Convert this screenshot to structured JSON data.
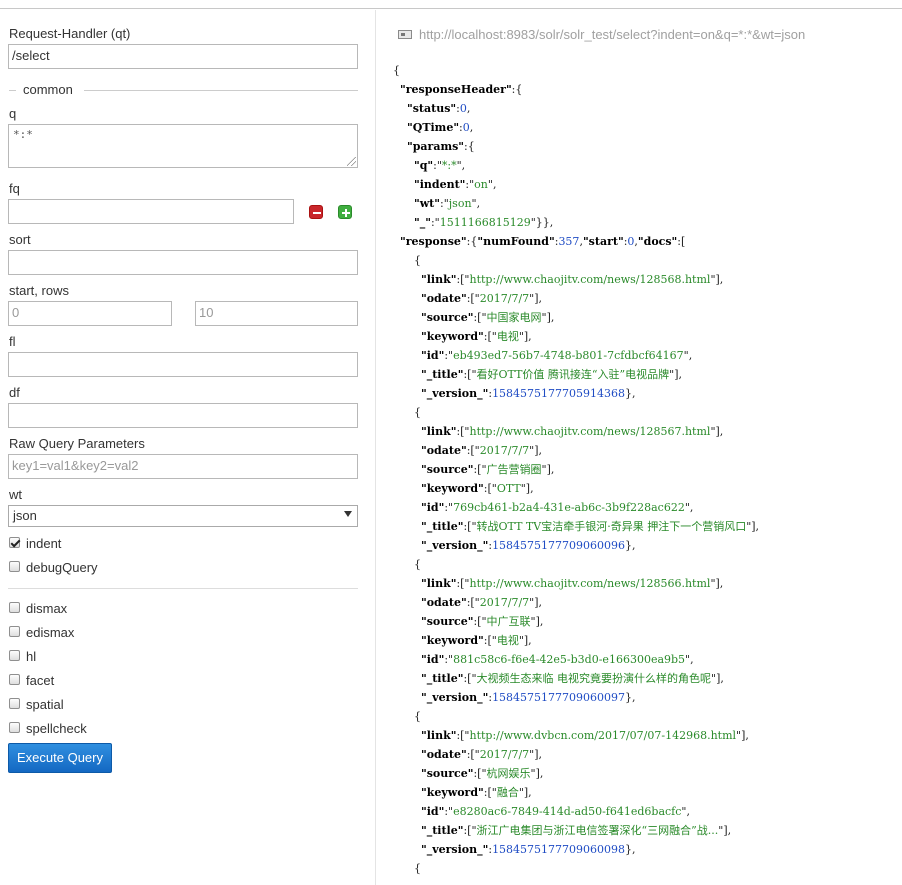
{
  "form": {
    "request_handler_label": "Request-Handler (qt)",
    "request_handler_value": "/select",
    "common_label": "common",
    "q_label": "q",
    "q_value": "*:*",
    "fq_label": "fq",
    "fq_value": "",
    "sort_label": "sort",
    "sort_value": "",
    "start_rows_label": "start, rows",
    "start_placeholder": "0",
    "rows_placeholder": "10",
    "fl_label": "fl",
    "fl_value": "",
    "df_label": "df",
    "df_value": "",
    "raw_label": "Raw Query Parameters",
    "raw_placeholder": "key1=val1&key2=val2",
    "wt_label": "wt",
    "wt_selected": "json",
    "indent_label": "indent",
    "indent_checked": true,
    "debug_label": "debugQuery",
    "dismax_label": "dismax",
    "edismax_label": "edismax",
    "hl_label": "hl",
    "facet_label": "facet",
    "spatial_label": "spatial",
    "spellcheck_label": "spellcheck",
    "execute_label": "Execute Query"
  },
  "result": {
    "url": "http://localhost:8983/solr/solr_test/select?indent=on&q=*:*&wt=json",
    "responseHeader": {
      "status": 0,
      "QTime": 0,
      "params": {
        "q": "*:*",
        "indent": "on",
        "wt": "json",
        "_": "1511166815129"
      }
    },
    "numFound": 357,
    "start": 0,
    "docs": [
      {
        "link": "http://www.chaojitv.com/news/128568.html",
        "odate": "2017/7/7",
        "source": "中国家电网",
        "keyword": "电视",
        "id": "eb493ed7-56b7-4748-b801-7cfdbcf64167",
        "title": "看好OTT价值 腾讯接连“入驻”电视品牌",
        "version": "1584575177705914368"
      },
      {
        "link": "http://www.chaojitv.com/news/128567.html",
        "odate": "2017/7/7",
        "source": "广告营销圈",
        "keyword": "OTT",
        "id": "769cb461-b2a4-431e-ab6c-3b9f228ac622",
        "title": "转战OTT TV宝洁牵手银河·奇异果 押注下一个营销风口",
        "version": "1584575177709060096"
      },
      {
        "link": "http://www.chaojitv.com/news/128566.html",
        "odate": "2017/7/7",
        "source": "中广互联",
        "keyword": "电视",
        "id": "881c58c6-f6e4-42e5-b3d0-e166300ea9b5",
        "title": "大视频生态来临 电视究竟要扮演什么样的角色呢",
        "version": "1584575177709060097"
      },
      {
        "link": "http://www.dvbcn.com/2017/07/07-142968.html",
        "odate": "2017/7/7",
        "source": "杭网娱乐",
        "keyword": "融合",
        "id": "e8280ac6-7849-414d-ad50-f641ed6bacfc",
        "title": "浙江广电集团与浙江电信签署深化“三网融合”战...",
        "version": "1584575177709060098"
      }
    ]
  }
}
